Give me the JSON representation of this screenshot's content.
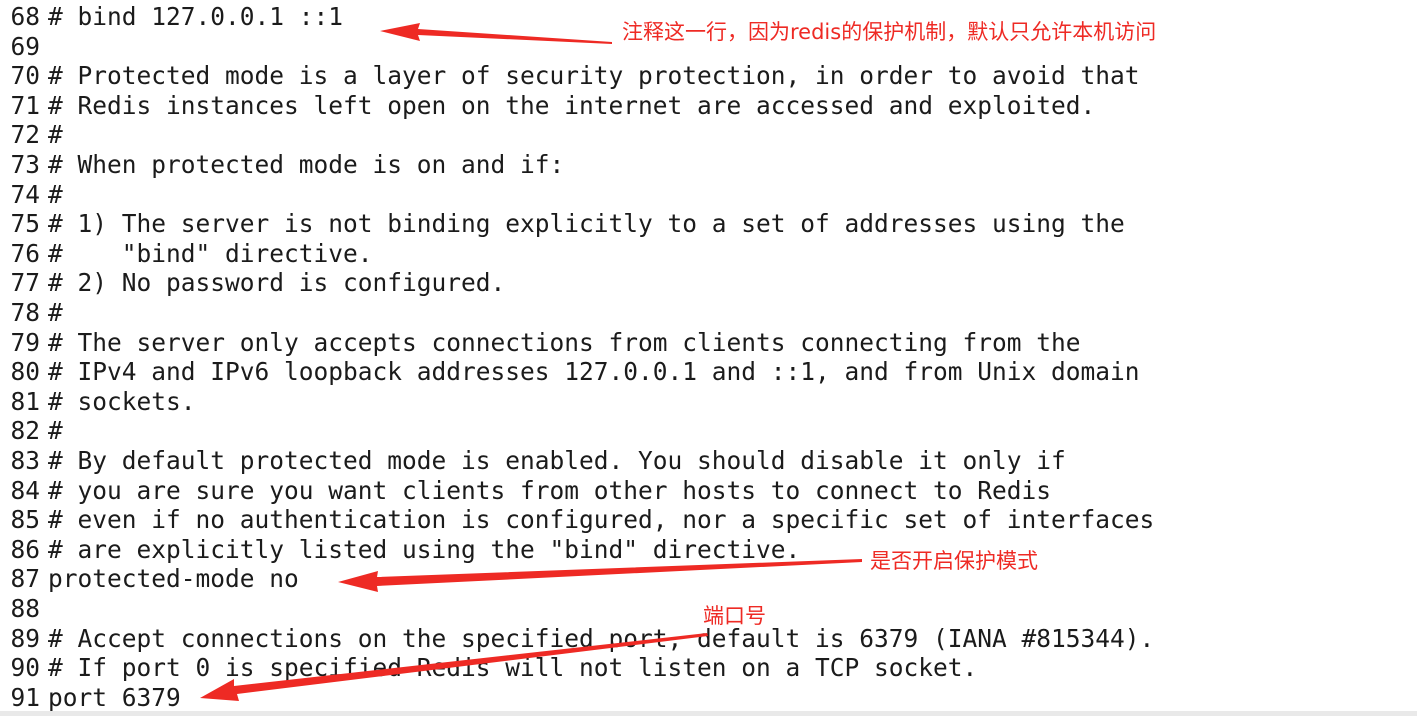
{
  "editor": {
    "lines": [
      {
        "num": "68",
        "text": "# bind 127.0.0.1 ::1"
      },
      {
        "num": "69",
        "text": ""
      },
      {
        "num": "70",
        "text": "# Protected mode is a layer of security protection, in order to avoid that"
      },
      {
        "num": "71",
        "text": "# Redis instances left open on the internet are accessed and exploited."
      },
      {
        "num": "72",
        "text": "#"
      },
      {
        "num": "73",
        "text": "# When protected mode is on and if:"
      },
      {
        "num": "74",
        "text": "#"
      },
      {
        "num": "75",
        "text": "# 1) The server is not binding explicitly to a set of addresses using the"
      },
      {
        "num": "76",
        "text": "#    \"bind\" directive."
      },
      {
        "num": "77",
        "text": "# 2) No password is configured."
      },
      {
        "num": "78",
        "text": "#"
      },
      {
        "num": "79",
        "text": "# The server only accepts connections from clients connecting from the"
      },
      {
        "num": "80",
        "text": "# IPv4 and IPv6 loopback addresses 127.0.0.1 and ::1, and from Unix domain"
      },
      {
        "num": "81",
        "text": "# sockets."
      },
      {
        "num": "82",
        "text": "#"
      },
      {
        "num": "83",
        "text": "# By default protected mode is enabled. You should disable it only if"
      },
      {
        "num": "84",
        "text": "# you are sure you want clients from other hosts to connect to Redis"
      },
      {
        "num": "85",
        "text": "# even if no authentication is configured, nor a specific set of interfaces"
      },
      {
        "num": "86",
        "text": "# are explicitly listed using the \"bind\" directive."
      },
      {
        "num": "87",
        "text": "protected-mode no"
      },
      {
        "num": "88",
        "text": ""
      },
      {
        "num": "89",
        "text": "# Accept connections on the specified port, default is 6379 (IANA #815344)."
      },
      {
        "num": "90",
        "text": "# If port 0 is specified Redis will not listen on a TCP socket."
      },
      {
        "num": "91",
        "text": "port 6379"
      }
    ]
  },
  "annotations": {
    "bind_note": "注释这一行，因为redis的保护机制，默认只允许本机访问",
    "protected_note": "是否开启保护模式",
    "port_note": "端口号",
    "color": "#ee2a24"
  }
}
